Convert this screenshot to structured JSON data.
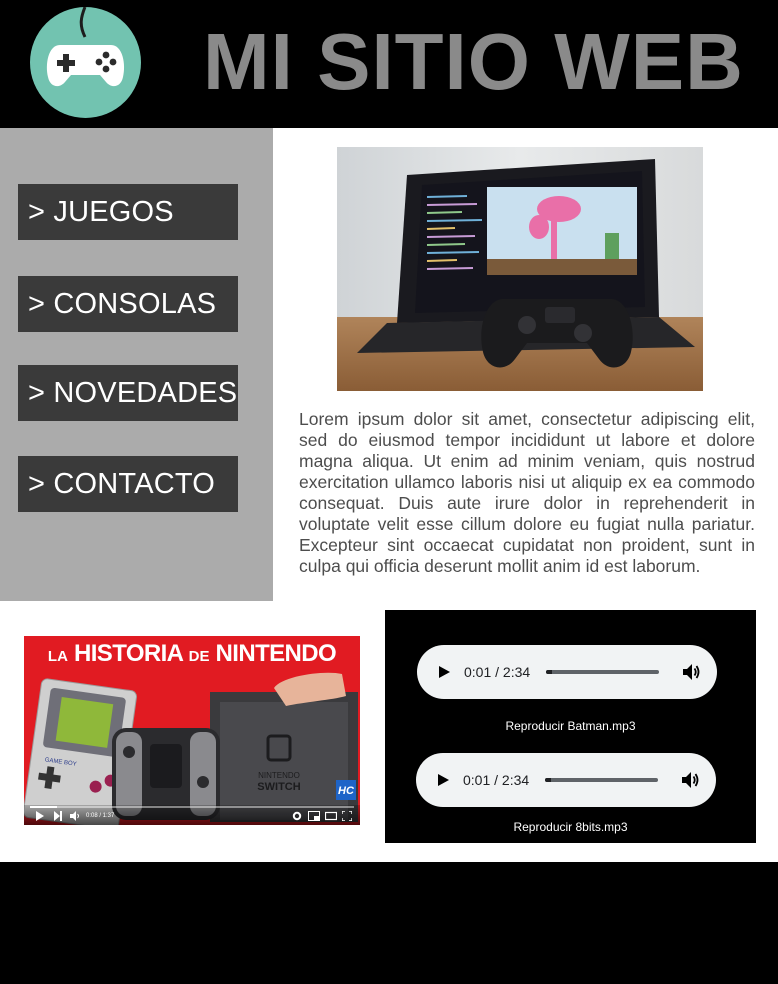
{
  "header": {
    "title": "MI SITIO WEB",
    "logo_icon": "gamepad-icon",
    "background": "#000000",
    "title_color": "#8a8a8a"
  },
  "nav": {
    "items": [
      {
        "label": "> JUEGOS"
      },
      {
        "label": "> CONSOLAS"
      },
      {
        "label": "> NOVEDADES"
      },
      {
        "label": "> CONTACTO"
      }
    ],
    "sidebar_color": "#ababab",
    "button_color": "#3a3a3a"
  },
  "main": {
    "hero_image": "laptop-with-game-controller-photo",
    "paragraph": "Lorem ipsum dolor sit amet, consectetur adipiscing elit, sed do eiusmod tempor incididunt ut labore et dolore magna aliqua. Ut enim ad minim veniam, quis nostrud exercitation ullamco laboris nisi ut aliquip ex ea commodo consequat. Duis aute irure dolor in reprehenderit in voluptate velit esse cillum dolore eu fugiat nulla pariatur. Excepteur sint occaecat cupidatat non proident, sunt in culpa qui officia deserunt mollit anim id est laborum."
  },
  "video": {
    "title_la": "LA",
    "title_historia": "HISTORIA",
    "title_de": "DE",
    "title_nintendo": "NINTENDO",
    "device_left_brand": "GAME BOY",
    "device_right_brand": "NINTENDO",
    "device_right_model": "SWITCH",
    "channel_badge": "HC",
    "time": "0:08 / 1:37",
    "progress_fraction": 0.082,
    "accent": "#e11b22"
  },
  "audio": {
    "players": [
      {
        "time": "0:01 / 2:34",
        "label": "Reproducir Batman.mp3",
        "progress_fraction": 0.0065
      },
      {
        "time": "0:01 / 2:34",
        "label": "Reproducir 8bits.mp3",
        "progress_fraction": 0.0065
      }
    ]
  },
  "footer": {
    "background": "#000000"
  }
}
